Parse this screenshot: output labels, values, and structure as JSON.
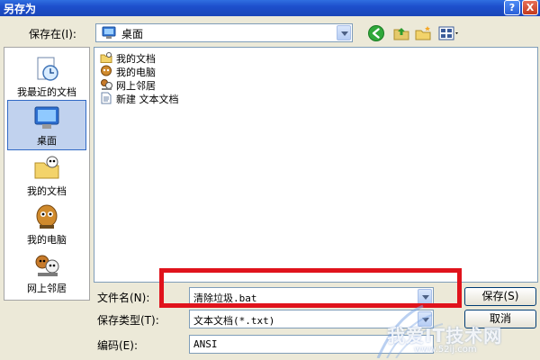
{
  "window": {
    "title": "另存为",
    "help_label": "?",
    "close_label": "X"
  },
  "toolbar": {
    "save_in_label": "保存在(I):",
    "location_value": "桌面",
    "location_icon": "desktop-icon",
    "back_icon": "back-arrow-icon",
    "up_icon": "up-folder-icon",
    "new_folder_icon": "new-folder-icon",
    "view_icon": "view-menu-icon"
  },
  "places": [
    {
      "label": "我最近的文档",
      "icon": "recent-documents-icon"
    },
    {
      "label": "桌面",
      "icon": "desktop-icon",
      "selected": true
    },
    {
      "label": "我的文档",
      "icon": "my-documents-icon"
    },
    {
      "label": "我的电脑",
      "icon": "my-computer-icon"
    },
    {
      "label": "网上邻居",
      "icon": "network-places-icon"
    }
  ],
  "files": [
    {
      "label": "我的文档",
      "icon": "my-documents-icon"
    },
    {
      "label": "我的电脑",
      "icon": "my-computer-icon"
    },
    {
      "label": "网上邻居",
      "icon": "network-places-icon"
    },
    {
      "label": "新建 文本文档",
      "icon": "text-file-icon"
    }
  ],
  "form": {
    "filename_label": "文件名(N):",
    "filename_value": "清除垃圾.bat",
    "filetype_label": "保存类型(T):",
    "filetype_value": "文本文档(*.txt)",
    "encoding_label": "编码(E):",
    "encoding_value": "ANSI",
    "save_button": "保存(S)",
    "cancel_button": "取消"
  },
  "watermark": {
    "text": "我爱IT技术网",
    "sub": "www.52ij.com"
  },
  "colors": {
    "titlebar": "#1d4fcc",
    "highlight": "#e0131c",
    "dialog_bg": "#ece9d8"
  }
}
